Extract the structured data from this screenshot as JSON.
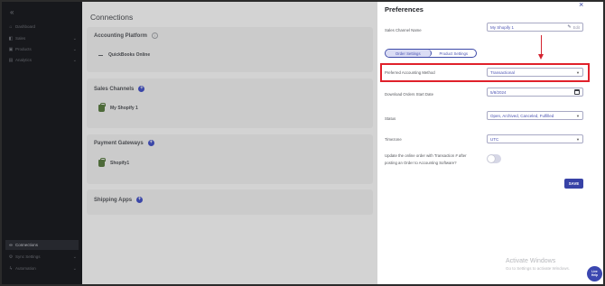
{
  "sidebar": {
    "toggle_icon": "double-chevron-left-icon",
    "items": [
      {
        "label": "Dashboard",
        "icon": "home-icon",
        "has_chevron": false
      },
      {
        "label": "Sales",
        "icon": "cart-icon",
        "has_chevron": true
      },
      {
        "label": "Products",
        "icon": "box-icon",
        "has_chevron": true
      },
      {
        "label": "Analytics",
        "icon": "chart-icon",
        "has_chevron": true
      }
    ],
    "bottom_items": [
      {
        "label": "Connections",
        "icon": "link-icon",
        "active": true
      },
      {
        "label": "Sync Settings",
        "icon": "gear-icon",
        "has_chevron": true
      },
      {
        "label": "Automation",
        "icon": "bolt-icon",
        "has_chevron": true
      }
    ]
  },
  "main": {
    "title": "Connections",
    "accounting": {
      "title": "Accounting Platform",
      "item": "QuickBooks Online"
    },
    "sales_channels": {
      "title": "Sales Channels",
      "item": "My Shopify 1"
    },
    "payment_gateways": {
      "title": "Payment Gateways",
      "item": "Shopify1"
    },
    "shipping_apps": {
      "title": "Shipping Apps"
    }
  },
  "panel": {
    "title": "Preferences",
    "sales_channel_name": {
      "label": "Sales Channel Name",
      "value": "My Shopify 1",
      "edit_label": "Edit"
    },
    "tabs": [
      {
        "label": "Order Settings",
        "active": true
      },
      {
        "label": "Product Settings",
        "active": false
      }
    ],
    "accounting_method": {
      "label": "Preferred Accounting Method",
      "value": "Transactional"
    },
    "start_date": {
      "label": "Download Orders Start Date",
      "value": "5/8/2024"
    },
    "status": {
      "label": "Status",
      "value": "Open, Archived, Canceled, Fulfilled"
    },
    "timezone": {
      "label": "Timezone",
      "value": "UTC"
    },
    "update_order": {
      "label_line1": "Update the online order with Transaction # after",
      "label_line2": "posting an Order to Accounting Software?",
      "enabled": false
    },
    "save_label": "SAVE"
  },
  "watermark": {
    "title": "Activate Windows",
    "subtitle": "Go to Settings to activate Windows."
  },
  "chat": {
    "line1": "Live",
    "line2": "Help"
  },
  "colors": {
    "accent": "#3742a6",
    "highlight": "#e0212b",
    "sidebar_bg": "#17181c"
  }
}
